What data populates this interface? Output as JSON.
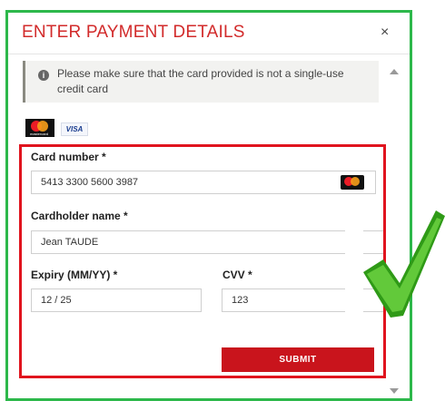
{
  "modal": {
    "title": "ENTER PAYMENT DETAILS",
    "close_symbol": "×"
  },
  "notice": {
    "icon": "info-icon",
    "text": "Please make sure that the card provided is not a single-use credit card"
  },
  "card_brands": [
    {
      "name": "mastercard",
      "label": "mastercard"
    },
    {
      "name": "visa",
      "label": "VISA"
    }
  ],
  "form": {
    "card_number_label": "Card number *",
    "card_number_value": "5413 3300 5600 3987",
    "card_brand_icon": "mastercard-icon",
    "cardholder_label": "Cardholder name *",
    "cardholder_value": "Jean TAUDE",
    "expiry_label": "Expiry  (MM/YY) *",
    "expiry_value": "12 / 25",
    "cvv_label": "CVV *",
    "cvv_value": "123",
    "submit_label": "SUBMIT"
  },
  "colors": {
    "title": "#d22b2b",
    "highlight_border": "#e0141e",
    "modal_border": "#2db84b",
    "submit_bg": "#c9141c",
    "checkmark": "#3fae1f"
  }
}
